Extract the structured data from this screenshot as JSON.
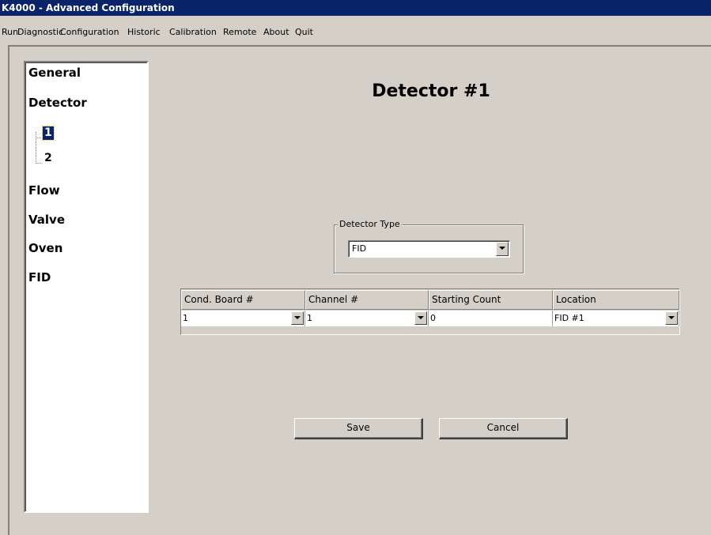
{
  "window": {
    "title": "K4000 - Advanced Configuration"
  },
  "menu": [
    "Run",
    "Diagnostic",
    "Configuration",
    "Historic",
    "Calibration",
    "Remote",
    "About",
    "Quit"
  ],
  "tree": {
    "general": "General",
    "detector": "Detector",
    "detector_children": [
      "1",
      "2"
    ],
    "selected_child": "1",
    "flow": "Flow",
    "valve": "Valve",
    "oven": "Oven",
    "fid": "FID"
  },
  "page_title": "Detector #1",
  "detector_type": {
    "label": "Detector Type",
    "value": "FID"
  },
  "grid": {
    "columns": [
      "Cond. Board #",
      "Channel #",
      "Starting Count",
      "Location"
    ],
    "row": [
      "1",
      "1",
      "0",
      "FID #1"
    ]
  },
  "buttons": {
    "save": "Save",
    "cancel": "Cancel"
  }
}
